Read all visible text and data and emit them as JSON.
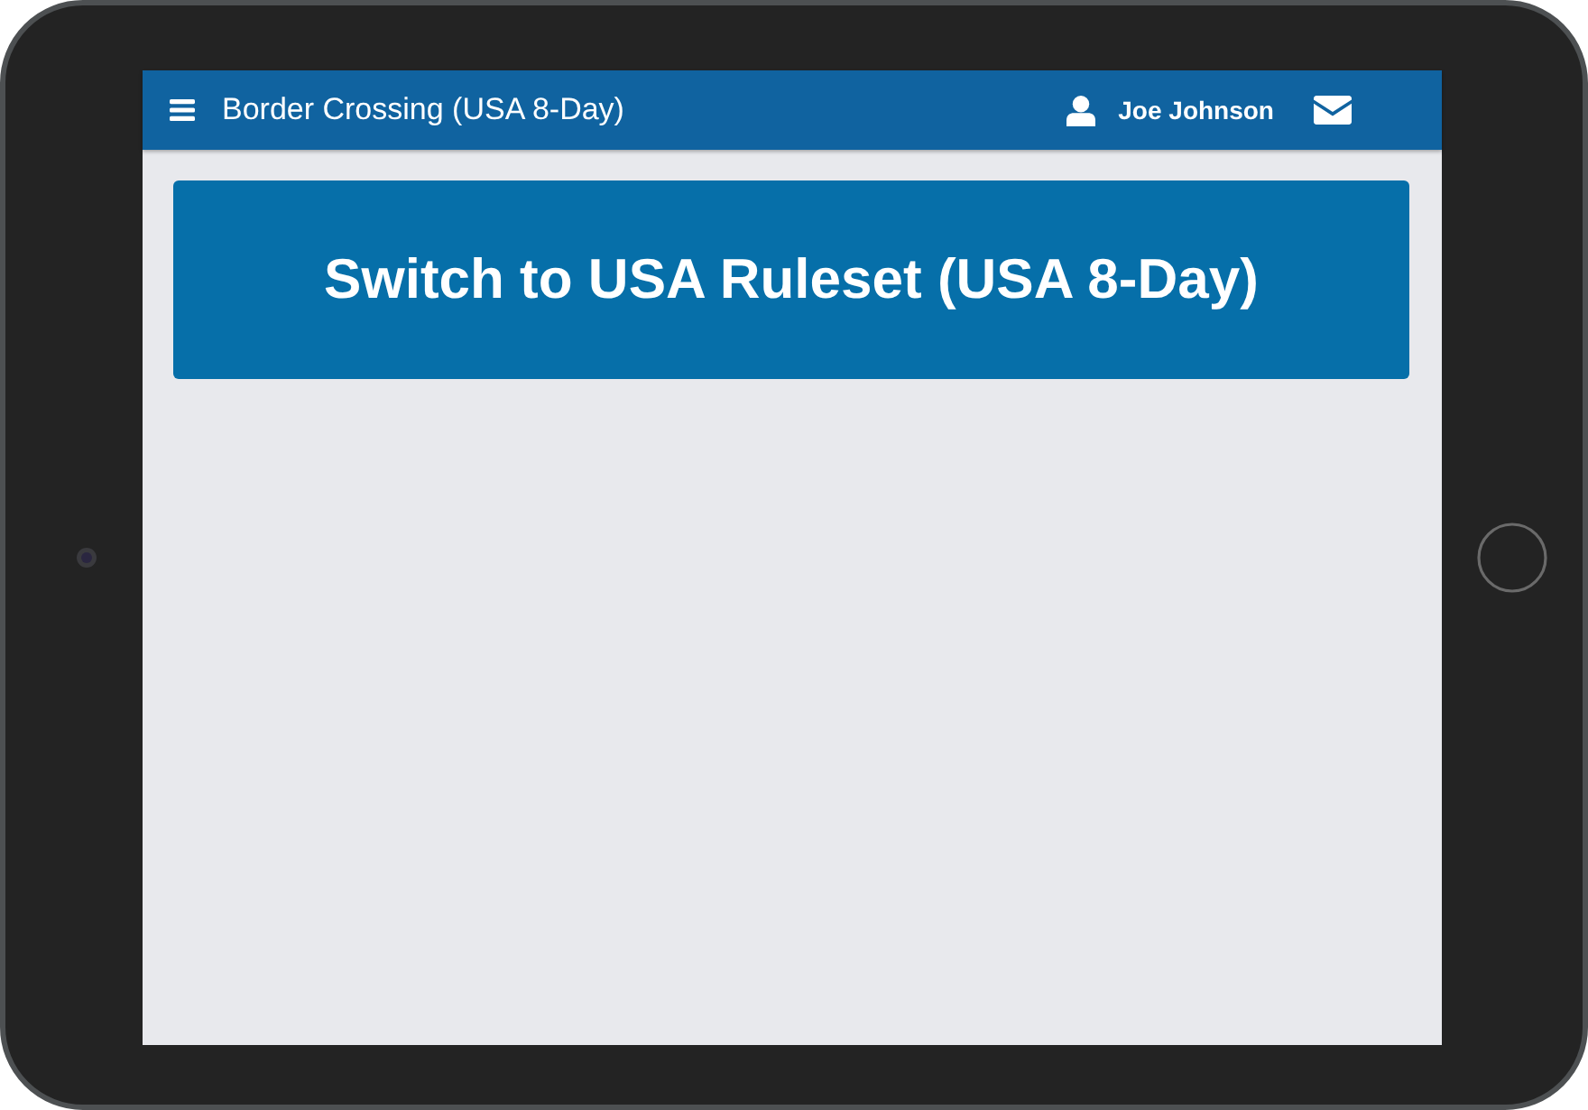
{
  "header": {
    "title": "Border Crossing (USA 8-Day)",
    "user_name": "Joe Johnson"
  },
  "action_button": {
    "label": "Switch to USA Ruleset (USA 8-Day)"
  }
}
